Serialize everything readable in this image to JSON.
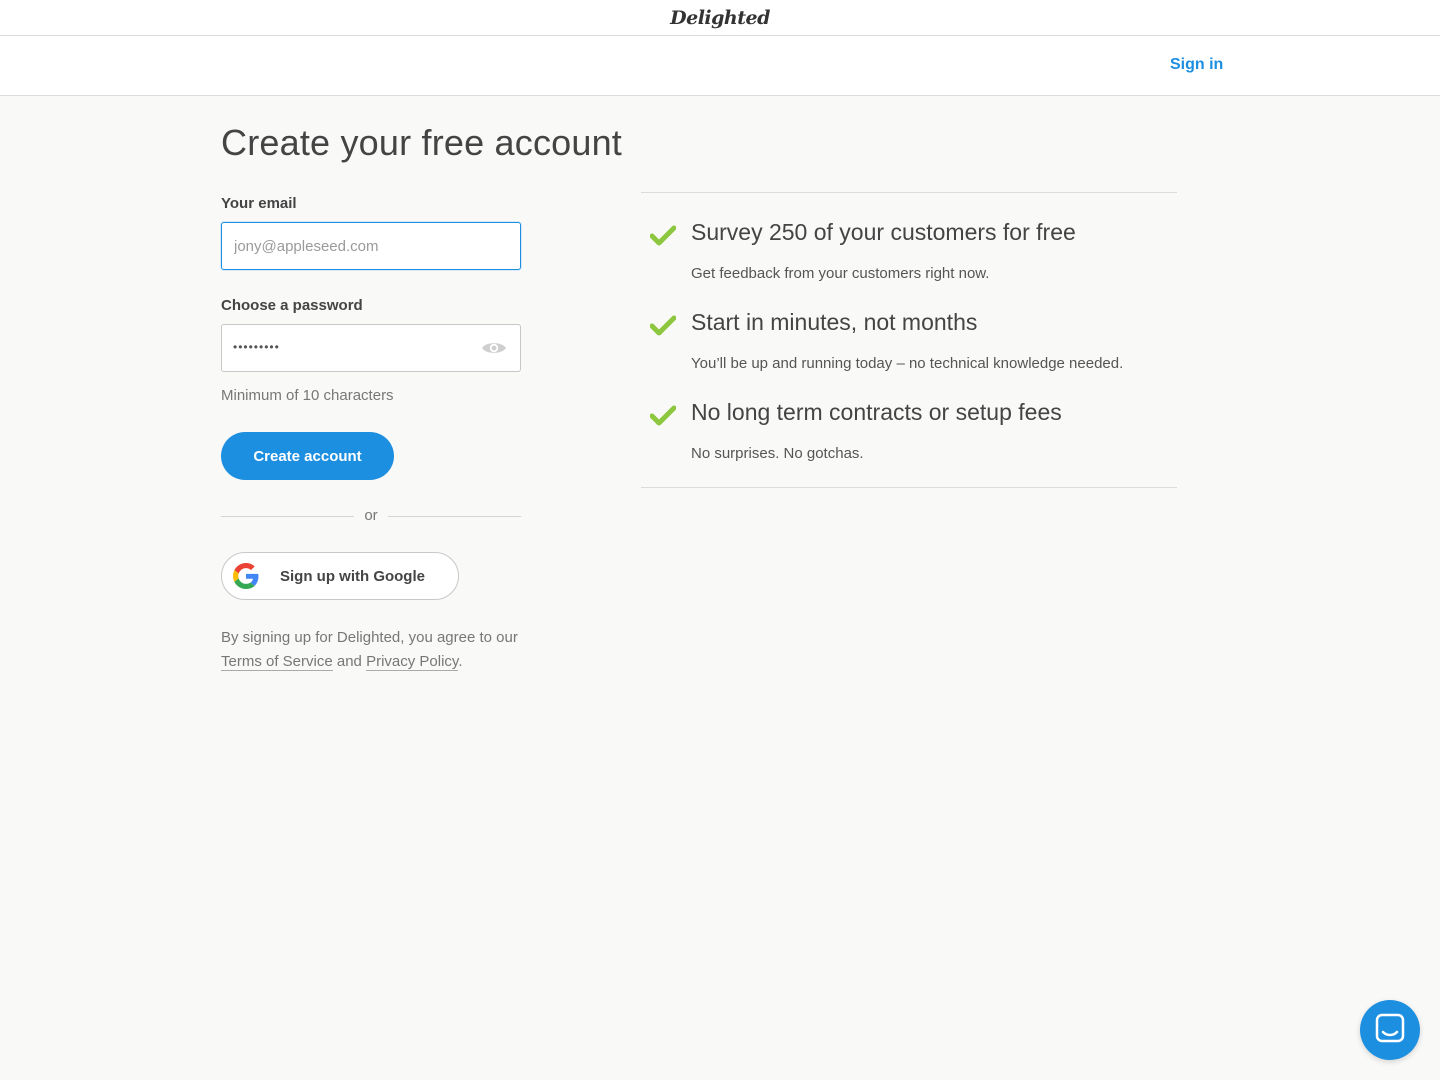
{
  "header": {
    "logo_text": "Delighted"
  },
  "nav": {
    "signin_label": "Sign in"
  },
  "page": {
    "title": "Create your free account"
  },
  "form": {
    "email_label": "Your email",
    "email_placeholder": "jony@appleseed.com",
    "password_label": "Choose a password",
    "password_masked": "•••••••••",
    "password_hint": "Minimum of 10 characters",
    "submit_label": "Create account",
    "or_text": "or",
    "google_label": "Sign up with Google",
    "legal_prefix": "By signing up for Delighted, you agree to our",
    "terms_label": "Terms of Service",
    "legal_and": "and",
    "privacy_label": "Privacy Policy",
    "legal_suffix": "."
  },
  "features": [
    {
      "title": "Survey 250 of your customers for free",
      "desc": "Get feedback from your customers right now."
    },
    {
      "title": "Start in minutes, not months",
      "desc": "You’ll be up and running today – no technical knowledge needed."
    },
    {
      "title": "No long term contracts or setup fees",
      "desc": "No surprises. No gotchas."
    }
  ],
  "icons": {
    "check": "check-icon",
    "eye": "eye-icon",
    "google": "google-icon",
    "chat": "chat-icon"
  },
  "colors": {
    "accent": "#1d8fe1",
    "check": "#8dc63f",
    "background": "#f9f9f8"
  }
}
